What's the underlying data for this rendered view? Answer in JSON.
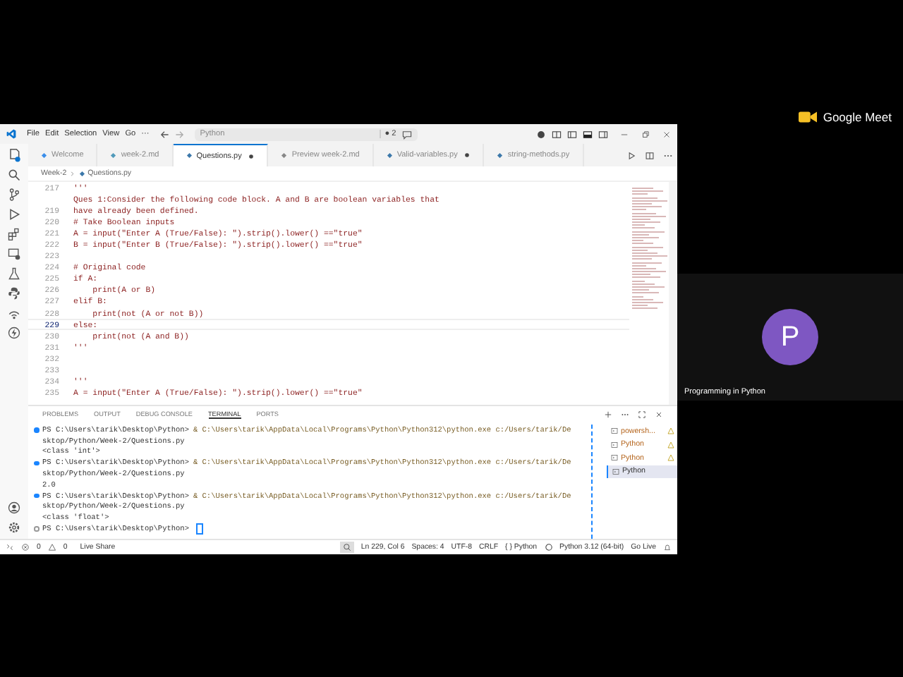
{
  "titlebar": {
    "menus": [
      "File",
      "Edit",
      "Selection",
      "View",
      "Go",
      "···"
    ],
    "search": {
      "value": "Python"
    },
    "badge": "● 2"
  },
  "tabs": [
    {
      "label": "Welcome",
      "kind": "welcome",
      "selected": false,
      "modified": false
    },
    {
      "label": "week-2.md",
      "kind": "markdown",
      "selected": false,
      "modified": false
    },
    {
      "label": "Questions.py",
      "kind": "python",
      "selected": true,
      "modified": true
    },
    {
      "label": "Preview week-2.md",
      "kind": "preview",
      "selected": false,
      "modified": false
    },
    {
      "label": "Valid-variables.py",
      "kind": "python",
      "selected": false,
      "modified": true
    },
    {
      "label": "string-methods.py",
      "kind": "python",
      "selected": false,
      "modified": false
    }
  ],
  "breadcrumb": [
    "Week-2",
    "Questions.py"
  ],
  "editor": {
    "lines": [
      {
        "num": "217",
        "text": "'''",
        "current": false
      },
      {
        "text": "Ques 1:Consider the following code block. A and B are boolean variables that",
        "current": false
      },
      {
        "num": "219",
        "text": "have already been defined.",
        "current": false
      },
      {
        "num": "220",
        "text": "# Take Boolean inputs",
        "current": false
      },
      {
        "num": "221",
        "text": "A = input(\"Enter A (True/False): \").strip().lower() ==\"true\"",
        "current": false
      },
      {
        "num": "222",
        "text": "B = input(\"Enter B (True/False): \").strip().lower() ==\"true\"",
        "current": false
      },
      {
        "num": "223",
        "current": false
      },
      {
        "num": "224",
        "text": "# Original code",
        "current": false
      },
      {
        "num": "225",
        "text": "if A:",
        "current": false
      },
      {
        "num": "226",
        "text": "    print(A or B)",
        "current": false
      },
      {
        "num": "227",
        "text": "elif B:",
        "current": false
      },
      {
        "num": "228",
        "text": "    print(not (A or not B))",
        "current": false
      },
      {
        "num": "229",
        "text": "else:",
        "current": true
      },
      {
        "num": "230",
        "text": "    print(not (A and B))",
        "current": false
      },
      {
        "num": "231",
        "text": "'''",
        "current": false
      },
      {
        "num": "232",
        "current": false
      },
      {
        "num": "233",
        "current": false
      },
      {
        "num": "234",
        "text": "'''",
        "current": false
      },
      {
        "num": "235",
        "text": "A = input(\"Enter A (True/False): \").strip().lower() ==\"true\"",
        "current": false
      }
    ]
  },
  "panel": {
    "tabs": [
      {
        "label": "PROBLEMS",
        "selected": false
      },
      {
        "label": "OUTPUT",
        "selected": false
      },
      {
        "label": "DEBUG CONSOLE",
        "selected": false
      },
      {
        "label": "TERMINAL",
        "selected": true
      },
      {
        "label": "PORTS",
        "selected": false
      }
    ],
    "terminal": [
      {
        "kind": "prompt",
        "completed": true,
        "prompt": "PS C:\\Users\\tarik\\Desktop\\Python>",
        "command": "& C:\\Users\\tarik\\AppData\\Local\\Programs\\Python\\Python312\\python.exe c:/Users/tarik/De"
      },
      {
        "kind": "output",
        "text": "sktop/Python/Week-2/Questions.py"
      },
      {
        "kind": "output",
        "text": "<class 'int'>"
      },
      {
        "kind": "prompt",
        "completed": true,
        "prompt": "PS C:\\Users\\tarik\\Desktop\\Python>",
        "command": "& C:\\Users\\tarik\\AppData\\Local\\Programs\\Python\\Python312\\python.exe c:/Users/tarik/De"
      },
      {
        "kind": "output",
        "text": "sktop/Python/Week-2/Questions.py"
      },
      {
        "kind": "output",
        "text": "2.0"
      },
      {
        "kind": "prompt",
        "completed": true,
        "prompt": "PS C:\\Users\\tarik\\Desktop\\Python>",
        "command": "& C:\\Users\\tarik\\AppData\\Local\\Programs\\Python\\Python312\\python.exe c:/Users/tarik/De"
      },
      {
        "kind": "output",
        "text": "sktop/Python/Week-2/Questions.py"
      },
      {
        "kind": "output",
        "text": "<class 'float'>"
      },
      {
        "kind": "prompt",
        "completed": false,
        "prompt": "PS C:\\Users\\tarik\\Desktop\\Python>"
      }
    ],
    "sessions": [
      {
        "label": "powersh...",
        "warning": true,
        "selected": false
      },
      {
        "label": "Python",
        "warning": true,
        "selected": false
      },
      {
        "label": "Python",
        "warning": true,
        "selected": false
      },
      {
        "label": "Python",
        "warning": false,
        "selected": true
      }
    ]
  },
  "status_bar": {
    "errors": "0",
    "warnings": "0",
    "live_share": "Live Share",
    "items": [
      "Ln 229, Col 6",
      "Spaces: 4",
      "UTF-8",
      "CRLF",
      "{ } Python"
    ],
    "interpreter": "Python 3.12 (64-bit)",
    "go_live": "Go Live"
  },
  "meet": {
    "logo": "Google Meet",
    "participant": {
      "initial": "P",
      "name": "Programming in Python"
    }
  }
}
